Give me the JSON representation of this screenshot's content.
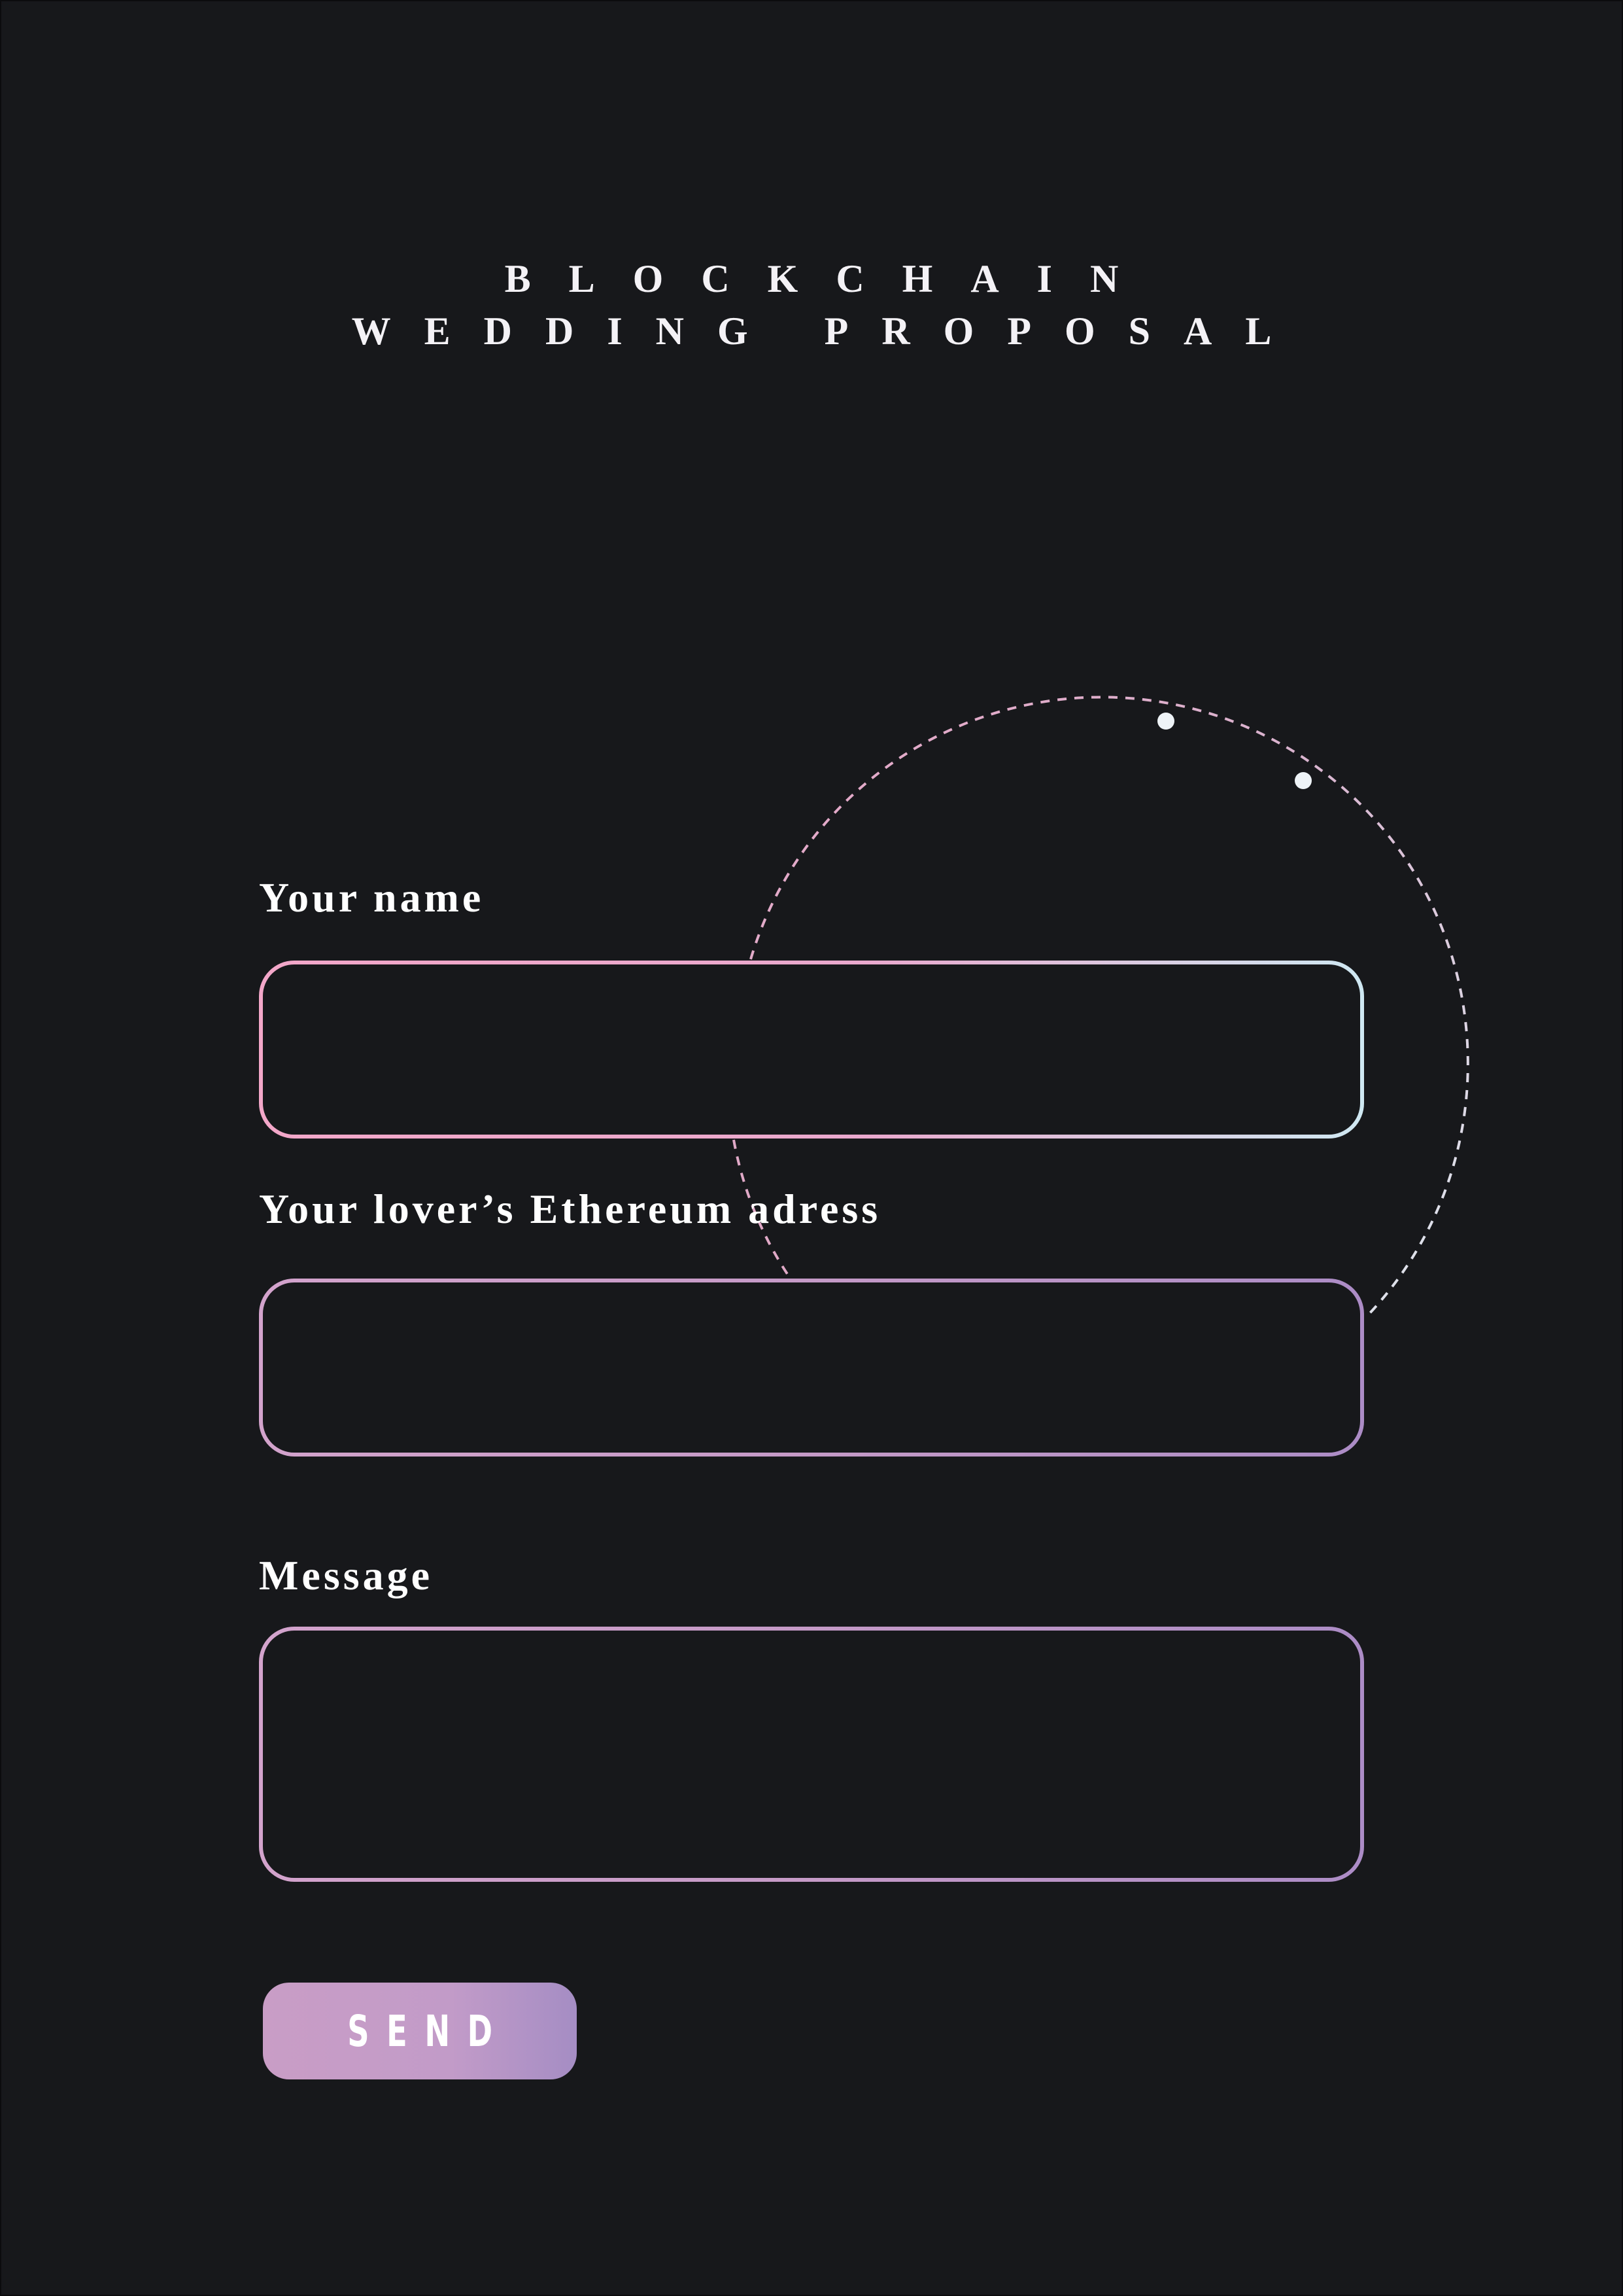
{
  "title": {
    "line1": "BLOCKCHAIN",
    "line2": "WEDDING PROPOSAL"
  },
  "form": {
    "name": {
      "label": "Your name",
      "value": "",
      "placeholder": ""
    },
    "address": {
      "label": "Your lover’s Ethereum adress",
      "value": "",
      "placeholder": ""
    },
    "message": {
      "label": "Message",
      "value": "",
      "placeholder": ""
    },
    "send_label": "SEND"
  },
  "colors": {
    "background": "#17181b",
    "accent_pink": "#f3a7c9",
    "accent_lilac": "#c59ac7",
    "accent_purple": "#a58dc4",
    "accent_ice": "#cfe8f2",
    "text": "#ffffff"
  },
  "decoration": {
    "orbit": "dashed-orbit-circle",
    "orbit_dots": [
      "orbit-dot-icon",
      "orbit-dot-icon"
    ]
  }
}
